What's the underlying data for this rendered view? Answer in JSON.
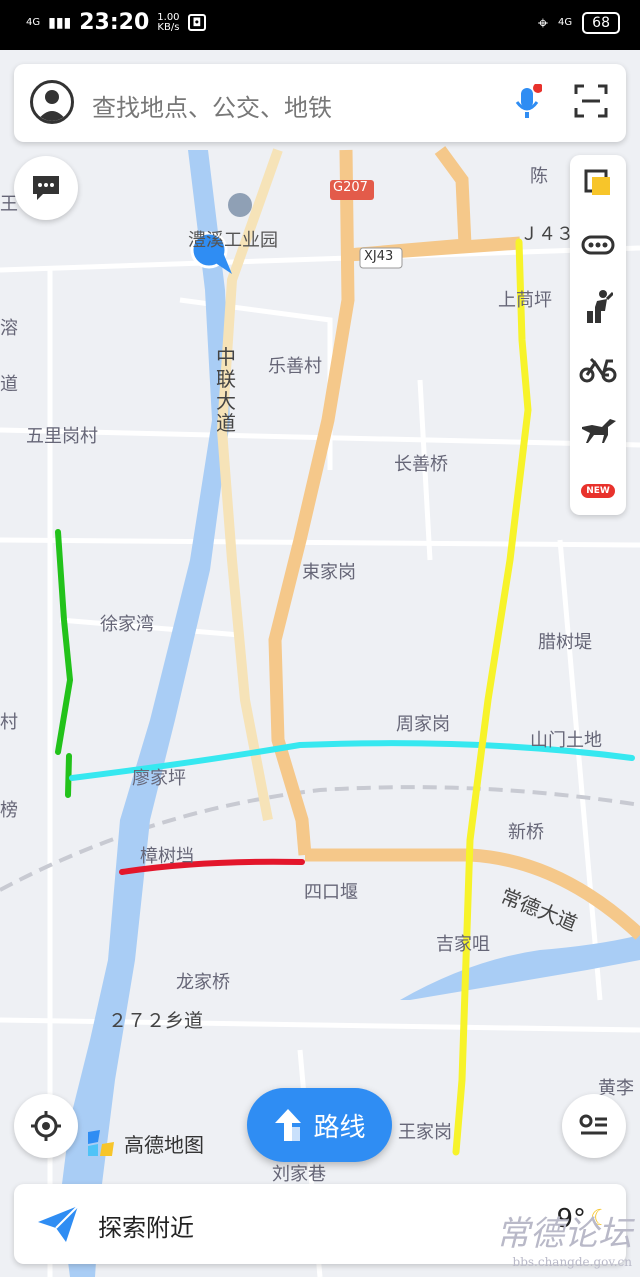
{
  "status": {
    "network": "4G",
    "time": "23:20",
    "speed_value": "1.00",
    "speed_unit": "KB/s",
    "network2": "4G",
    "battery": "68"
  },
  "search": {
    "placeholder": "查找地点、公交、地铁"
  },
  "map": {
    "road_shields": [
      "G207",
      "XJ43"
    ],
    "labels": {
      "industrial_park": "澧溪工业园",
      "zhonglian_road": "中联大道",
      "leshan": "乐善村",
      "wuligang": "五里岗村",
      "changshanqiao": "长善桥",
      "shangjiaping": "上茼坪",
      "shujiagang": "束家岗",
      "xujiawan": "徐家湾",
      "lashudi": "腊树堤",
      "zhoujiagang": "周家岗",
      "shanmen": "山门土地",
      "liaojiaping": "廖家坪",
      "xinqiao": "新桥",
      "zhangshudang": "樟树垱",
      "sikouyan": "四口堰",
      "changde_road": "常德大道",
      "jijiaju": "吉家咀",
      "longjiaqiao": "龙家桥",
      "road_272": "２７２乡道",
      "wangjiagang": "王家岗",
      "liujiaxiang": "刘家巷",
      "huangli": "黄李",
      "j43": "Ｊ４３",
      "edge_rong": "溶",
      "edge_dao": "道",
      "edge_cun": "村",
      "edge_bang": "榜",
      "edge_wang": "王",
      "edge_chen": "陈",
      "edge_dao2": "道"
    }
  },
  "toolbar": {
    "items": [
      "layers-icon",
      "traffic-icon",
      "transit-icon",
      "bike-icon",
      "horse-icon"
    ],
    "new_badge": "NEW"
  },
  "route_button": {
    "label": "路线"
  },
  "logo": {
    "text": "高德地图"
  },
  "bottom": {
    "explore": "探索附近",
    "temperature": "9°"
  },
  "watermark": {
    "text": "常德论坛",
    "url": "bbs.changde.gov.cn"
  },
  "colors": {
    "river": "#a9cdf5",
    "main_road": "#f5c88a",
    "green_line": "#22c21a",
    "cyan_line": "#36e8f0",
    "yellow_line": "#f7f32a",
    "red_line": "#e3162b",
    "accent": "#2f8df3"
  }
}
